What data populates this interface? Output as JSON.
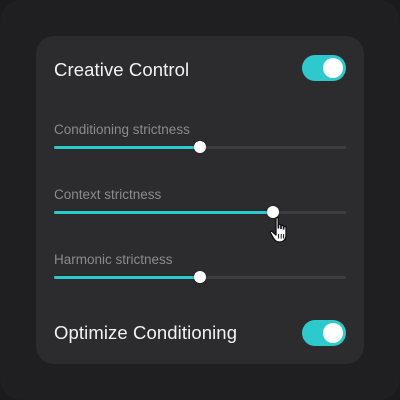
{
  "creative_control": {
    "label": "Creative Control",
    "enabled": true
  },
  "sliders": [
    {
      "label": "Conditioning strictness",
      "value": 0.5
    },
    {
      "label": "Context strictness",
      "value": 0.75
    },
    {
      "label": "Harmonic strictness",
      "value": 0.5
    }
  ],
  "optimize_conditioning": {
    "label": "Optimize Conditioning",
    "enabled": true
  },
  "colors": {
    "accent": "#2ec9cc",
    "panel": "#2c2c2e",
    "background": "#1b1b1d",
    "track": "#3e3e41"
  },
  "icons": {
    "pointer": "hand-pointer-icon"
  }
}
